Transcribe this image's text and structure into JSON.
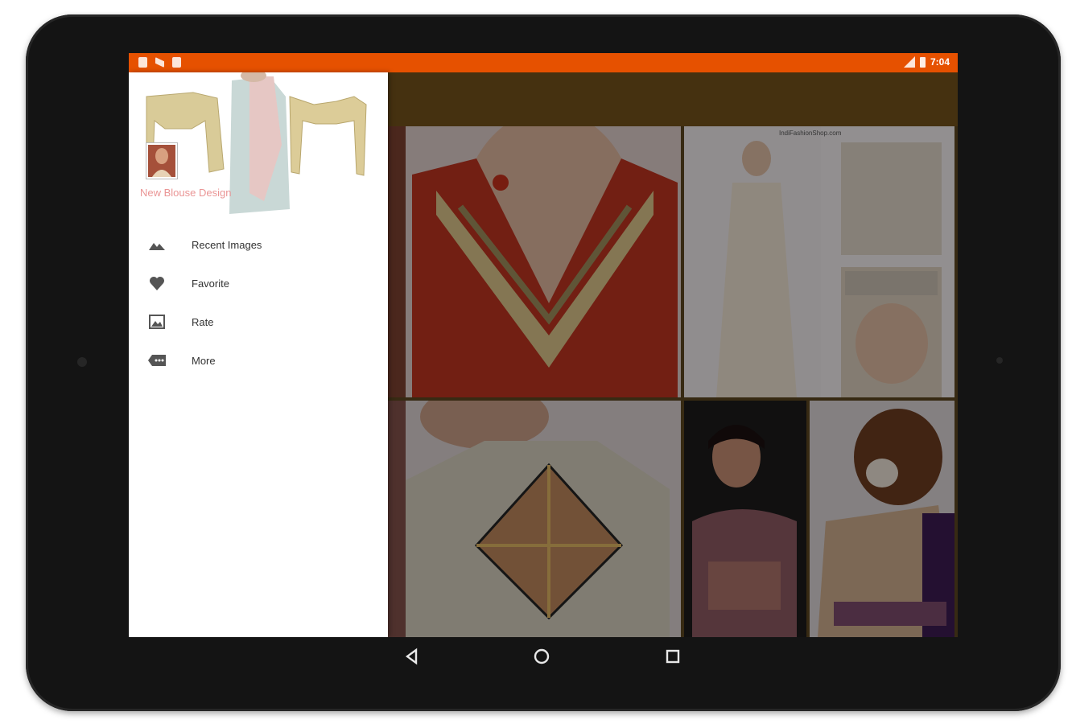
{
  "status_bar": {
    "time": "7:04",
    "icons": [
      "sd-card-icon",
      "notification-icon",
      "download-icon",
      "signal-icon",
      "battery-icon"
    ]
  },
  "drawer": {
    "app_title": "New Blouse Design",
    "items": [
      {
        "label": "Recent Images",
        "icon": "landscape-icon"
      },
      {
        "label": "Favorite",
        "icon": "heart-icon"
      },
      {
        "label": "Rate",
        "icon": "rate-image-icon"
      },
      {
        "label": "More",
        "icon": "more-apps-icon"
      }
    ]
  },
  "watermark": "IndiFashionShop.com",
  "navigation": {
    "buttons": [
      "back-icon",
      "home-icon",
      "recents-icon"
    ]
  },
  "colors": {
    "status_bar": "#e65100",
    "app_bar": "#704f1a",
    "drawer_title": "#e88a8a"
  }
}
